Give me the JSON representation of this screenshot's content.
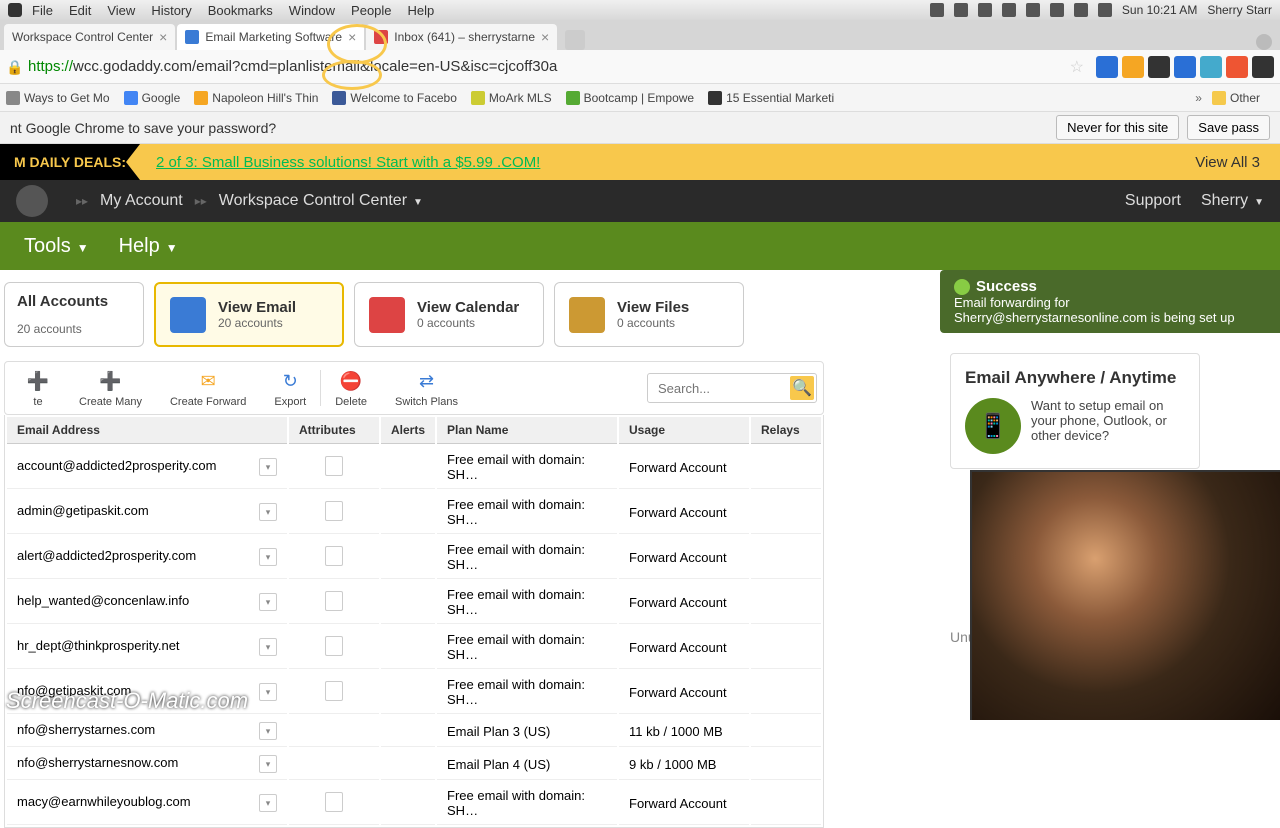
{
  "mac_menu": {
    "items": [
      "File",
      "Edit",
      "View",
      "History",
      "Bookmarks",
      "Window",
      "People",
      "Help"
    ],
    "time": "Sun 10:21 AM",
    "user": "Sherry Starr"
  },
  "tabs": [
    {
      "title": "Workspace Control Center",
      "active": false
    },
    {
      "title": "Email Marketing Software",
      "active": true
    },
    {
      "title": "Inbox (641) – sherrystarne",
      "active": false
    }
  ],
  "address": {
    "prefix": "https://",
    "url": "wcc.godaddy.com/email?cmd=planlistemail&locale=en-US&isc=cjcoff30a"
  },
  "bookmarks": [
    "Ways to Get Mo",
    "Google",
    "Napoleon Hill's Thin",
    "Welcome to Facebo",
    "MoArk MLS",
    "Bootcamp | Empowe",
    "15 Essential Marketi"
  ],
  "bookmarks_other": "Other",
  "password_bar": {
    "text": "nt Google Chrome to save your password?",
    "never": "Never for this site",
    "save": "Save pass"
  },
  "deals": {
    "label": "M DAILY DEALS:",
    "text": "2 of 3: Small Business solutions! Start with a $5.99 .COM!",
    "viewall": "View All 3"
  },
  "dark_header": {
    "account": "My Account",
    "wcc": "Workspace Control Center",
    "support": "Support",
    "user": "Sherry"
  },
  "green_nav": {
    "tools": "Tools",
    "help": "Help"
  },
  "cards": {
    "all": {
      "title": "All Accounts",
      "sub": "20 accounts"
    },
    "email": {
      "title": "View Email",
      "sub": "20 accounts"
    },
    "calendar": {
      "title": "View Calendar",
      "sub": "0 accounts"
    },
    "files": {
      "title": "View Files",
      "sub": "0 accounts"
    }
  },
  "toolbar": {
    "create": "te",
    "create_many": "Create Many",
    "create_forward": "Create Forward",
    "export": "Export",
    "delete": "Delete",
    "switch_plans": "Switch Plans",
    "search_placeholder": "Search..."
  },
  "table": {
    "headers": {
      "email": "Email Address",
      "attr": "Attributes",
      "alerts": "Alerts",
      "plan": "Plan Name",
      "usage": "Usage",
      "relays": "Relays"
    },
    "rows": [
      {
        "email": "account@addicted2prosperity.com",
        "plan": "Free email with domain: SH…",
        "usage": "Forward Account",
        "attr": true
      },
      {
        "email": "admin@getipaskit.com",
        "plan": "Free email with domain: SH…",
        "usage": "Forward Account",
        "attr": true
      },
      {
        "email": "alert@addicted2prosperity.com",
        "plan": "Free email with domain: SH…",
        "usage": "Forward Account",
        "attr": true
      },
      {
        "email": "help_wanted@concenlaw.info",
        "plan": "Free email with domain: SH…",
        "usage": "Forward Account",
        "attr": true
      },
      {
        "email": "hr_dept@thinkprosperity.net",
        "plan": "Free email with domain: SH…",
        "usage": "Forward Account",
        "attr": true
      },
      {
        "email": "nfo@getipaskit.com",
        "plan": "Free email with domain: SH…",
        "usage": "Forward Account",
        "attr": true
      },
      {
        "email": "nfo@sherrystarnes.com",
        "plan": "Email Plan 3 (US)",
        "usage": "11 kb / 1000 MB",
        "attr": false
      },
      {
        "email": "nfo@sherrystarnesnow.com",
        "plan": "Email Plan 4 (US)",
        "usage": "9 kb / 1000 MB",
        "attr": false
      },
      {
        "email": "macy@earnwhileyoublog.com",
        "plan": "Free email with domain: SH…",
        "usage": "Forward Account",
        "attr": true
      }
    ]
  },
  "success": {
    "title": "Success",
    "body": "Email forwarding for Sherry@sherrystarnesonline.com is being set up"
  },
  "anywhere": {
    "title": "Email Anywhere / Anytime",
    "text": "Want to setup email on your phone, Outlook, or other device?"
  },
  "unused": "Unused Plans",
  "watermark": "Screencast-O-Matic.com"
}
